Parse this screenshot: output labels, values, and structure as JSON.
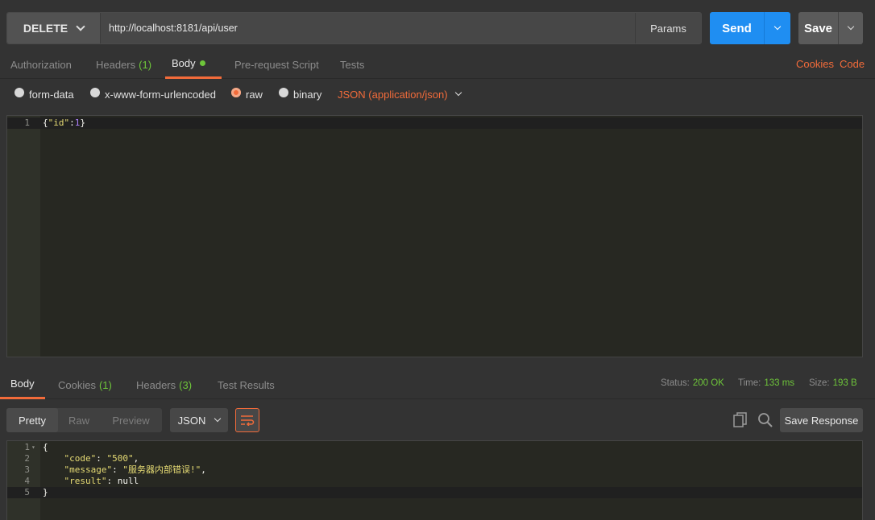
{
  "request": {
    "method": "DELETE",
    "url": "http://localhost:8181/api/user",
    "params_label": "Params",
    "send_label": "Send",
    "save_label": "Save"
  },
  "request_tabs": {
    "authorization": "Authorization",
    "headers": "Headers",
    "headers_count": "(1)",
    "body": "Body",
    "prerequest": "Pre-request Script",
    "tests": "Tests",
    "cookies": "Cookies",
    "code": "Code"
  },
  "body_types": {
    "form_data": "form-data",
    "urlencoded": "x-www-form-urlencoded",
    "raw": "raw",
    "binary": "binary",
    "content_type": "JSON (application/json)"
  },
  "request_body": {
    "line_number": "1",
    "open": "{",
    "key": "\"id\"",
    "colon": ":",
    "value": "1",
    "close": "}"
  },
  "response_tabs": {
    "body": "Body",
    "cookies": "Cookies",
    "cookies_count": "(1)",
    "headers": "Headers",
    "headers_count": "(3)",
    "test_results": "Test Results"
  },
  "response_status": {
    "status_label": "Status:",
    "status_value": "200 OK",
    "time_label": "Time:",
    "time_value": "133 ms",
    "size_label": "Size:",
    "size_value": "193 B"
  },
  "response_toolbar": {
    "pretty": "Pretty",
    "raw": "Raw",
    "preview": "Preview",
    "format": "JSON",
    "save_response": "Save Response"
  },
  "response_body": {
    "ln1": "1",
    "ln2": "2",
    "ln3": "3",
    "ln4": "4",
    "ln5": "5",
    "open": "{",
    "code_key": "\"code\"",
    "code_val": "\"500\"",
    "message_key": "\"message\"",
    "message_val": "\"服务器内部错误!\"",
    "result_key": "\"result\"",
    "result_val": "null",
    "close": "}"
  },
  "colors": {
    "accent": "#f26b3a",
    "send": "#1f8ef2",
    "success": "#6ec53a",
    "editor_bg": "#272822"
  }
}
